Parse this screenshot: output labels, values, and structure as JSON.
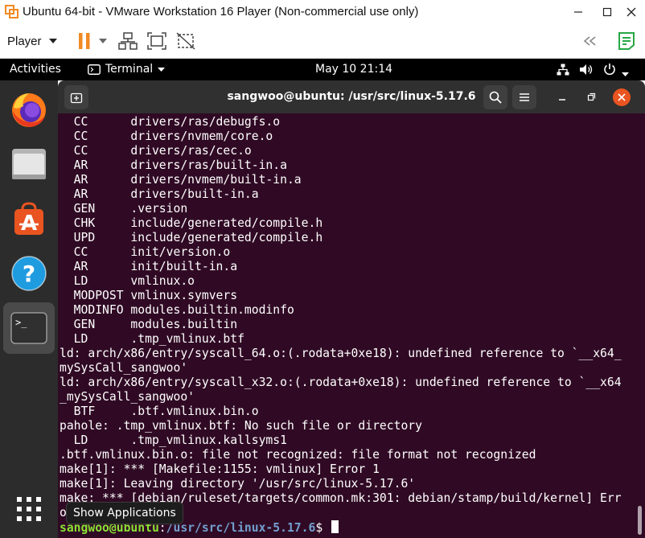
{
  "vm": {
    "title": "Ubuntu 64-bit - VMware Workstation 16 Player (Non-commercial use only)",
    "player_menu": "Player",
    "accent": "#f08a24"
  },
  "ubuntu_panel": {
    "activities": "Activities",
    "app_menu": "Terminal",
    "datetime": "May 10  21:14"
  },
  "dock": {
    "items": [
      "firefox-icon",
      "files-icon",
      "software-icon",
      "help-icon",
      "terminal-icon"
    ],
    "show_apps_tooltip": "Show Applications"
  },
  "terminal": {
    "title": "sangwoo@ubuntu: /usr/src/linux-5.17.6",
    "lines": [
      "  CC      drivers/ras/debugfs.o",
      "  CC      drivers/nvmem/core.o",
      "  CC      drivers/ras/cec.o",
      "  AR      drivers/ras/built-in.a",
      "  AR      drivers/nvmem/built-in.a",
      "  AR      drivers/built-in.a",
      "  GEN     .version",
      "  CHK     include/generated/compile.h",
      "  UPD     include/generated/compile.h",
      "  CC      init/version.o",
      "  AR      init/built-in.a",
      "  LD      vmlinux.o",
      "  MODPOST vmlinux.symvers",
      "  MODINFO modules.builtin.modinfo",
      "  GEN     modules.builtin",
      "  LD      .tmp_vmlinux.btf",
      "ld: arch/x86/entry/syscall_64.o:(.rodata+0xe18): undefined reference to `__x64_",
      "mySysCall_sangwoo'",
      "ld: arch/x86/entry/syscall_x32.o:(.rodata+0xe18): undefined reference to `__x64",
      "_mySysCall_sangwoo'",
      "  BTF     .btf.vmlinux.bin.o",
      "pahole: .tmp_vmlinux.btf: No such file or directory",
      "  LD      .tmp_vmlinux.kallsyms1",
      ".btf.vmlinux.bin.o: file not recognized: file format not recognized",
      "make[1]: *** [Makefile:1155: vmlinux] Error 1",
      "make[1]: Leaving directory '/usr/src/linux-5.17.6'",
      "make: *** [debian/ruleset/targets/common.mk:301: debian/stamp/build/kernel] Err",
      "or 2"
    ],
    "prompt_user": "sangwoo@ubuntu",
    "prompt_sep": ":",
    "prompt_path": "/usr/src/linux-5.17.6",
    "prompt_symbol": "$ ",
    "bg_color": "#300a24"
  }
}
